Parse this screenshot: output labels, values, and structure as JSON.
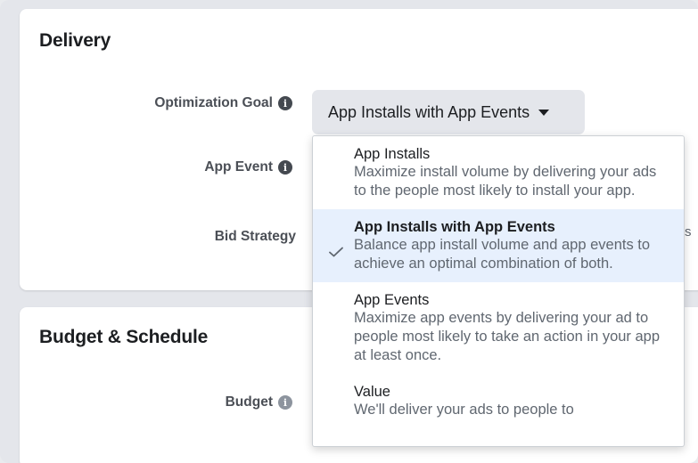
{
  "delivery": {
    "title": "Delivery",
    "fields": {
      "optimization_goal": "Optimization Goal",
      "app_event": "App Event",
      "bid_strategy": "Bid Strategy"
    },
    "dropdown": {
      "selected_value": "App Installs with App Events"
    },
    "clipped_text": "s"
  },
  "menu": {
    "options": [
      {
        "title": "App Installs",
        "description": "Maximize install volume by delivering your ads to the people most likely to install your app."
      },
      {
        "title": "App Installs with App Events",
        "description": "Balance app install volume and app events to achieve an optimal combination of both.",
        "selected": true
      },
      {
        "title": "App Events",
        "description": "Maximize app events by delivering your ad to people most likely to take an action in your app at least once."
      },
      {
        "title": "Value",
        "description": "We'll deliver your ads to people to"
      }
    ]
  },
  "budget_schedule": {
    "title": "Budget & Schedule",
    "fields": {
      "budget": "Budget"
    }
  },
  "icons": {
    "info": "info-icon",
    "caret": "caret-down-icon",
    "check": "checkmark-icon"
  },
  "colors": {
    "selected_bg": "#e7f0fd",
    "button_bg": "#e4e6eb",
    "label_color": "#4b4f56"
  }
}
